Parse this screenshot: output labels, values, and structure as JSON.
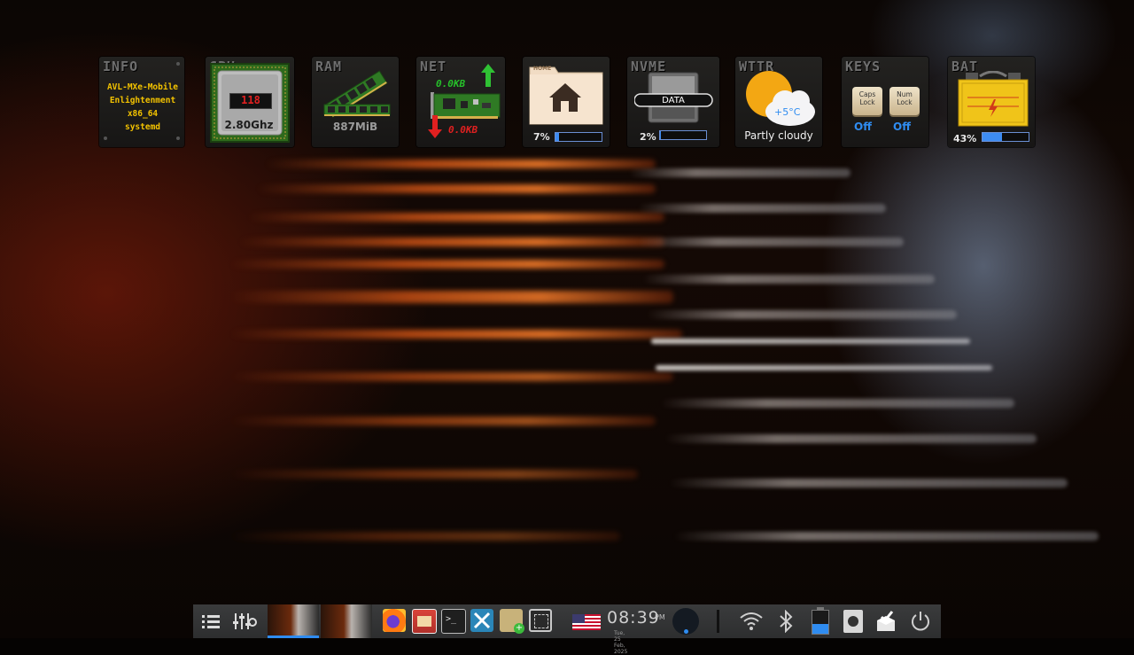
{
  "gadgets": {
    "info": {
      "title": "INFO",
      "lines": [
        "AVL-MXe-Mobile",
        "Enlightenment",
        "x86_64",
        "systemd"
      ]
    },
    "cpu": {
      "title": "CPU",
      "display": "118",
      "freq": "2.80Ghz"
    },
    "ram": {
      "title": "RAM",
      "value": "887MiB"
    },
    "net": {
      "title": "NET",
      "upload": "0.0KB",
      "download": "0.0KB"
    },
    "home": {
      "title": "HOME",
      "folder_tab": "HOME",
      "percent": "7%",
      "fill": 0.07
    },
    "nvme": {
      "title": "NVME",
      "drive_label": "DATA",
      "percent": "2%",
      "fill": 0.02
    },
    "wttr": {
      "title": "WTTR",
      "temperature": "+5°C",
      "condition": "Partly cloudy"
    },
    "keys": {
      "title": "KEYS",
      "caps_label": "Caps Lock",
      "caps_state": "Off",
      "num_label": "Num Lock",
      "num_state": "Off"
    },
    "bat": {
      "title": "BAT",
      "percent": "43%",
      "fill": 0.43
    }
  },
  "taskbar": {
    "clock": {
      "time": "08:39",
      "ampm": "PM",
      "date": "Tue, 25 Feb, 2025"
    },
    "icons": [
      "menu-icon",
      "mixer-icon",
      "firefox-icon",
      "app-icon",
      "terminal-icon",
      "settings-tools-icon",
      "installer-icon",
      "screenshot-icon",
      "us-flag-icon",
      "moon-icon",
      "wifi-icon",
      "bluetooth-icon",
      "battery-icon",
      "drive-icon",
      "package-icon",
      "power-icon"
    ],
    "colors": {
      "accent": "#2f8cf0",
      "bar": "#333435"
    }
  }
}
